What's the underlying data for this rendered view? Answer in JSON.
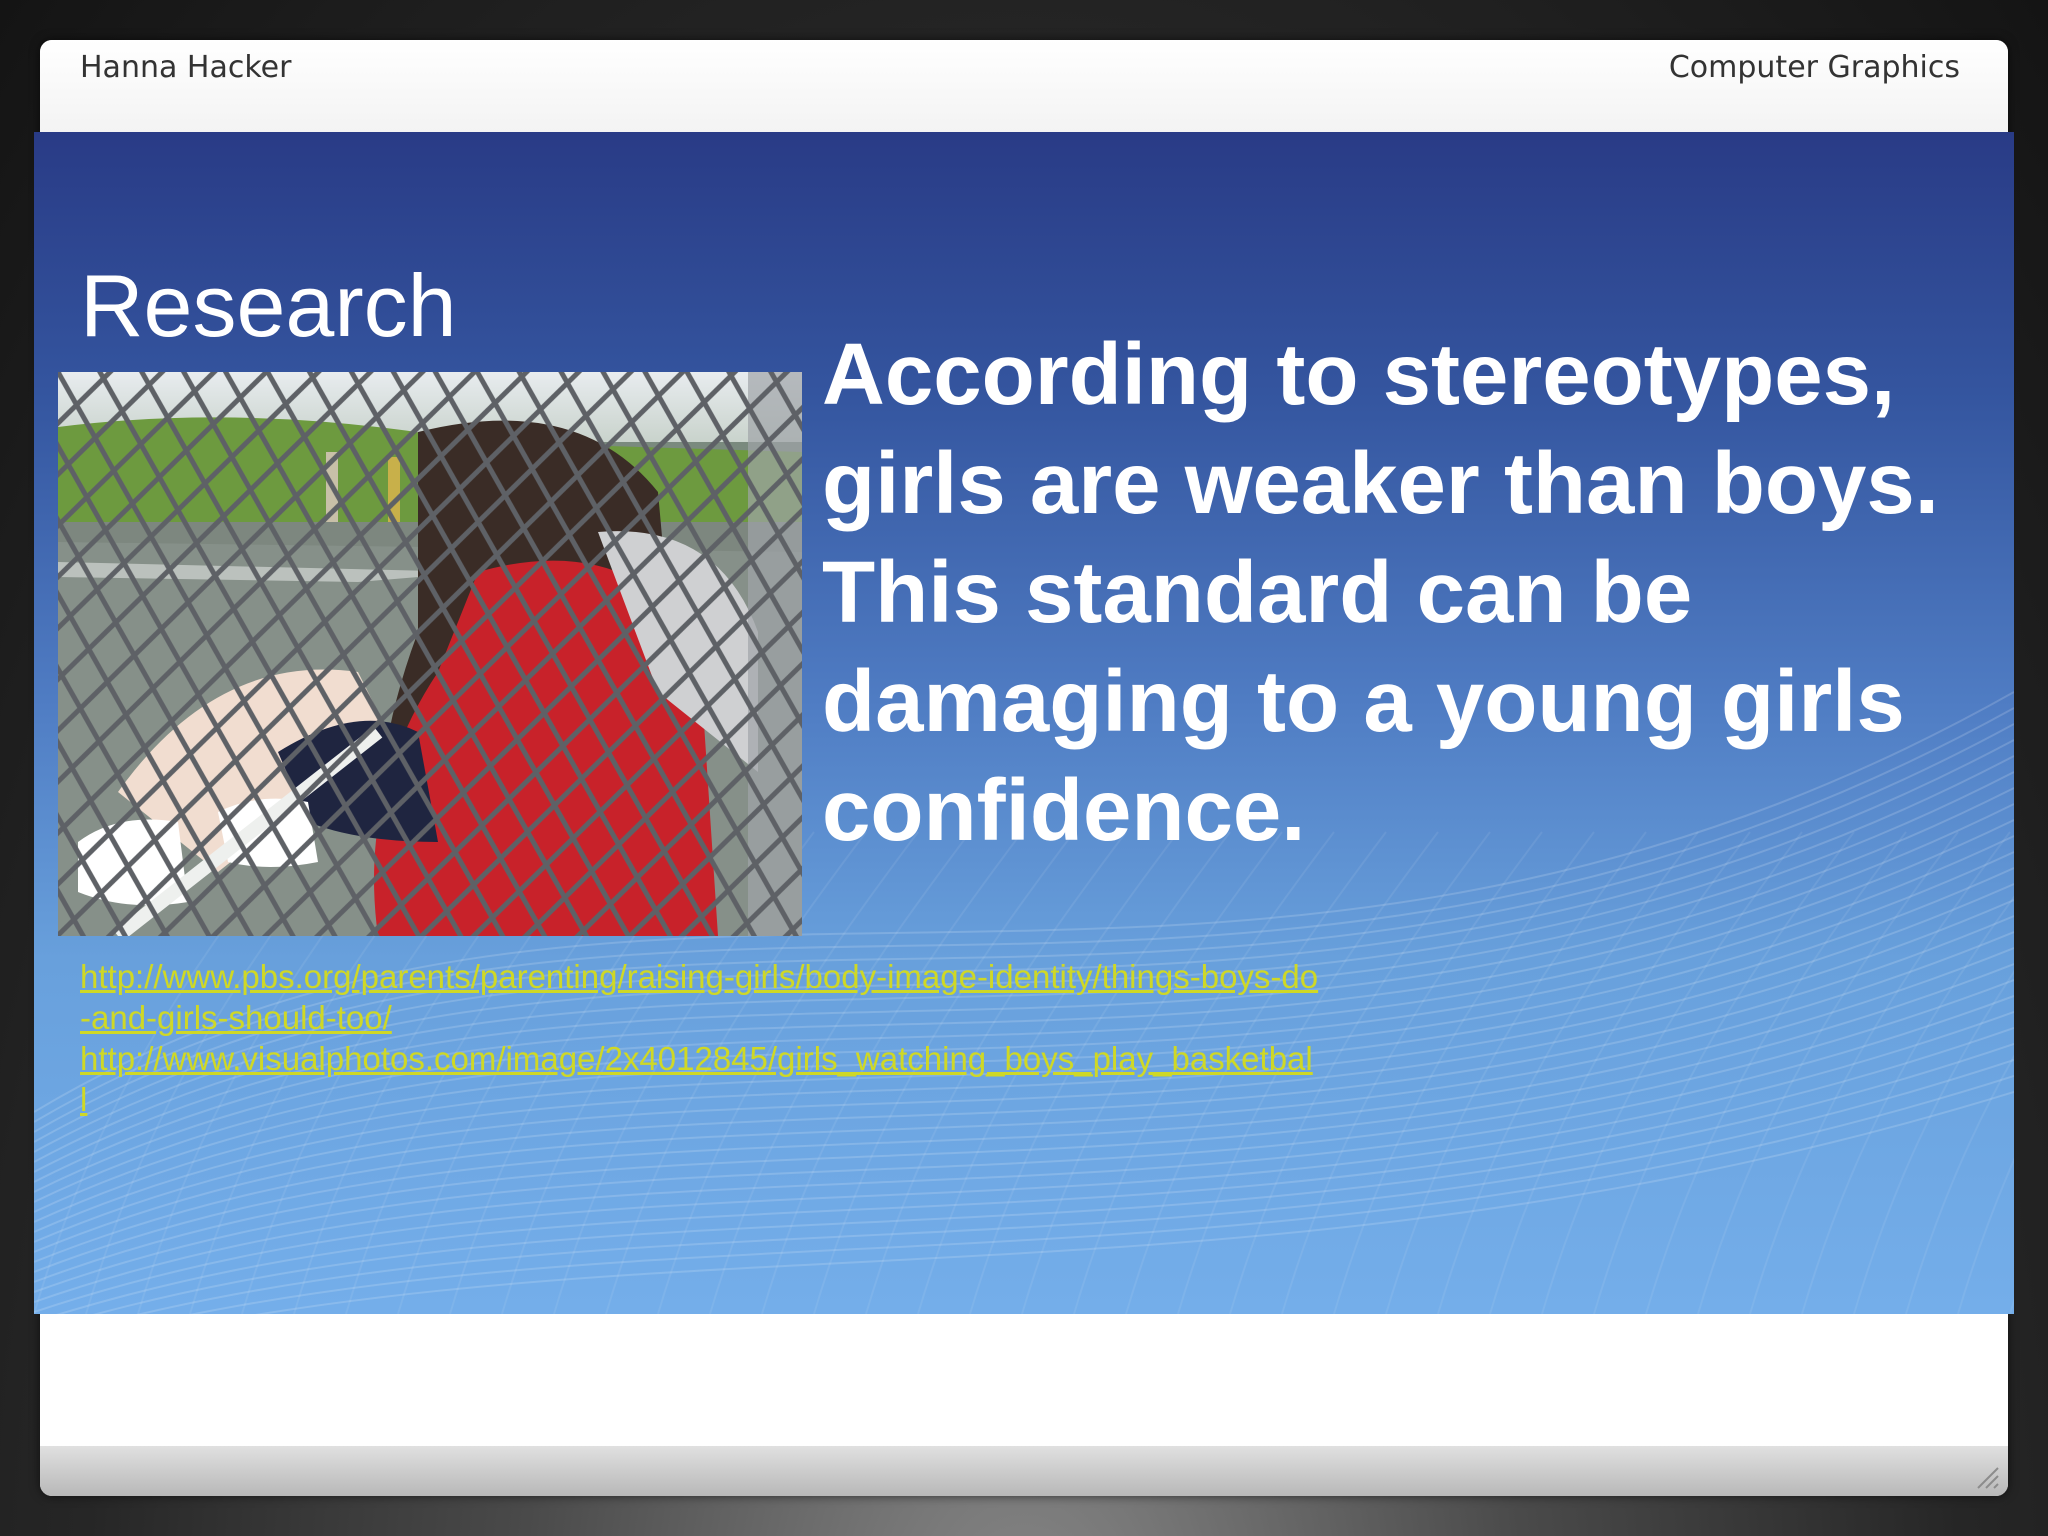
{
  "header": {
    "left_text": "Hanna Hacker",
    "right_text": "Computer Graphics"
  },
  "slide": {
    "title": "Research",
    "body": "According to stereotypes, girls are weaker than boys. This standard can be damaging to a young girls confidence.",
    "links": [
      "http://www.pbs.org/parents/parenting/raising-girls/body-image-identity/things-boys-do-and-girls-should-too/",
      "http://www.visualphotos.com/image/2x4012845/girls_watching_boys_play_basketball"
    ]
  },
  "icons": {
    "footer_grip": "resize-grip-icon"
  },
  "colors": {
    "panel_top": "#293b86",
    "panel_bottom": "#74aeea",
    "link": "#cfd826",
    "text": "#ffffff"
  }
}
